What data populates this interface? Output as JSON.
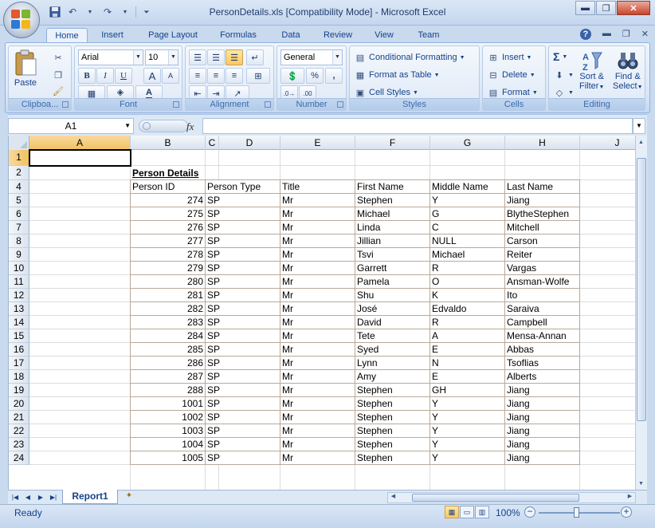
{
  "window": {
    "title": "PersonDetails.xls  [Compatibility Mode] - Microsoft Excel",
    "minimize": "▬",
    "restore": "❐",
    "close": "✕"
  },
  "tabs": [
    {
      "label": "Home",
      "active": true
    },
    {
      "label": "Insert"
    },
    {
      "label": "Page Layout"
    },
    {
      "label": "Formulas"
    },
    {
      "label": "Data"
    },
    {
      "label": "Review"
    },
    {
      "label": "View"
    },
    {
      "label": "Team"
    }
  ],
  "tab_right": {
    "help": "?",
    "min": "▬",
    "restore": "❐",
    "close": "✕"
  },
  "ribbon": {
    "clipboard": {
      "label": "Clipboa...",
      "paste": "Paste"
    },
    "font": {
      "label": "Font",
      "font_name": "Arial",
      "font_size": "10",
      "bold": "B",
      "italic": "I",
      "underline": "U",
      "grow": "A",
      "shrink": "A",
      "font_color_letter": "A"
    },
    "alignment": {
      "label": "Alignment"
    },
    "number": {
      "label": "Number",
      "format": "General",
      "percent": "%",
      "comma": ","
    },
    "styles": {
      "label": "Styles",
      "conditional": "Conditional Formatting",
      "format_table": "Format as Table",
      "cell_styles": "Cell Styles"
    },
    "cells": {
      "label": "Cells",
      "insert": "Insert",
      "delete": "Delete",
      "format": "Format"
    },
    "editing": {
      "label": "Editing",
      "sum": "Σ",
      "sort1": "Sort &",
      "sort2": "Filter",
      "find1": "Find &",
      "find2": "Select"
    }
  },
  "formula_bar": {
    "name_box": "A1",
    "fx": "fx",
    "value": ""
  },
  "grid": {
    "columns": [
      "A",
      "B",
      "C",
      "D",
      "E",
      "F",
      "G",
      "H",
      "J"
    ],
    "selected_column": "A",
    "selected_row": "1",
    "row_numbers": [
      "1",
      "2",
      "4",
      "5",
      "6",
      "7",
      "8",
      "9",
      "10",
      "11",
      "12",
      "13",
      "14",
      "15",
      "16",
      "17",
      "18",
      "19",
      "20",
      "21",
      "22",
      "23",
      "24"
    ],
    "report_title": "Person Details",
    "headers": [
      "Person ID",
      "Person Type",
      "Title",
      "First Name",
      "Middle Name",
      "Last Name"
    ],
    "rows": [
      [
        "274",
        "SP",
        "Mr",
        "Stephen",
        "Y",
        "Jiang"
      ],
      [
        "275",
        "SP",
        "Mr",
        "Michael",
        "G",
        "BlytheStephen"
      ],
      [
        "276",
        "SP",
        "Mr",
        "Linda",
        "C",
        "Mitchell"
      ],
      [
        "277",
        "SP",
        "Mr",
        "Jillian",
        "NULL",
        "Carson"
      ],
      [
        "278",
        "SP",
        "Mr",
        "Tsvi",
        "Michael",
        "Reiter"
      ],
      [
        "279",
        "SP",
        "Mr",
        "Garrett",
        "R",
        "Vargas"
      ],
      [
        "280",
        "SP",
        "Mr",
        "Pamela",
        "O",
        "Ansman-Wolfe"
      ],
      [
        "281",
        "SP",
        "Mr",
        "Shu",
        "K",
        "Ito"
      ],
      [
        "282",
        "SP",
        "Mr",
        "José",
        "Edvaldo",
        "Saraiva"
      ],
      [
        "283",
        "SP",
        "Mr",
        "David",
        "R",
        "Campbell"
      ],
      [
        "284",
        "SP",
        "Mr",
        "Tete",
        "A",
        "Mensa-Annan"
      ],
      [
        "285",
        "SP",
        "Mr",
        "Syed",
        "E",
        "Abbas"
      ],
      [
        "286",
        "SP",
        "Mr",
        "Lynn",
        "N",
        "Tsoflias"
      ],
      [
        "287",
        "SP",
        "Mr",
        "Amy",
        "E",
        "Alberts"
      ],
      [
        "288",
        "SP",
        "Mr",
        "Stephen",
        "GH",
        "Jiang"
      ],
      [
        "1001",
        "SP",
        "Mr",
        "Stephen",
        "Y",
        "Jiang"
      ],
      [
        "1002",
        "SP",
        "Mr",
        "Stephen",
        "Y",
        "Jiang"
      ],
      [
        "1003",
        "SP",
        "Mr",
        "Stephen",
        "Y",
        "Jiang"
      ],
      [
        "1004",
        "SP",
        "Mr",
        "Stephen",
        "Y",
        "Jiang"
      ],
      [
        "1005",
        "SP",
        "Mr",
        "Stephen",
        "Y",
        "Jiang"
      ]
    ]
  },
  "sheet_tabs": {
    "active": "Report1"
  },
  "status": {
    "text": "Ready",
    "zoom": "100%"
  },
  "colors": {
    "accent": "#15428b",
    "selected_header": "#f1c15f"
  }
}
